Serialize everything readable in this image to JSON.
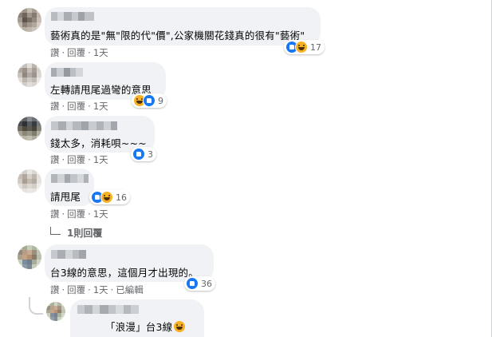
{
  "comments": [
    {
      "text": "藝術真的是\"無\"限的代\"價\",公家機關花錢真的很有\"藝術\"",
      "reactions": [
        "like",
        "haha"
      ],
      "reaction_count": "17",
      "actions": {
        "like": "讚",
        "reply": "回覆",
        "time": "1天"
      }
    },
    {
      "text": "左轉請甩尾過彎的意思",
      "reactions": [
        "haha",
        "like"
      ],
      "reaction_count": "9",
      "actions": {
        "like": "讚",
        "reply": "回覆",
        "time": "1天"
      }
    },
    {
      "text": "錢太多，消耗唄~~~",
      "reactions": [
        "like"
      ],
      "reaction_count": "3",
      "actions": {
        "like": "讚",
        "reply": "回覆",
        "time": "1天"
      }
    },
    {
      "text": "請甩尾",
      "reactions": [
        "like",
        "haha"
      ],
      "reaction_count": "16",
      "actions": {
        "like": "讚",
        "reply": "回覆",
        "time": "1天"
      },
      "replies_toggle": "1則回覆"
    },
    {
      "text": "台3線的意思，這個月才出現的。",
      "reactions": [
        "like"
      ],
      "reaction_count": "36",
      "actions": {
        "like": "讚",
        "reply": "回覆",
        "time": "1天",
        "edited": "已編輯"
      }
    }
  ],
  "reply": {
    "text": "「浪漫」台3線",
    "emoji": "haha-emoji"
  },
  "colors": {
    "bubble": "#f0f2f5",
    "meta_text": "#65676b",
    "like_blue": "#1877f2",
    "haha_yellow": "#f7b125"
  }
}
